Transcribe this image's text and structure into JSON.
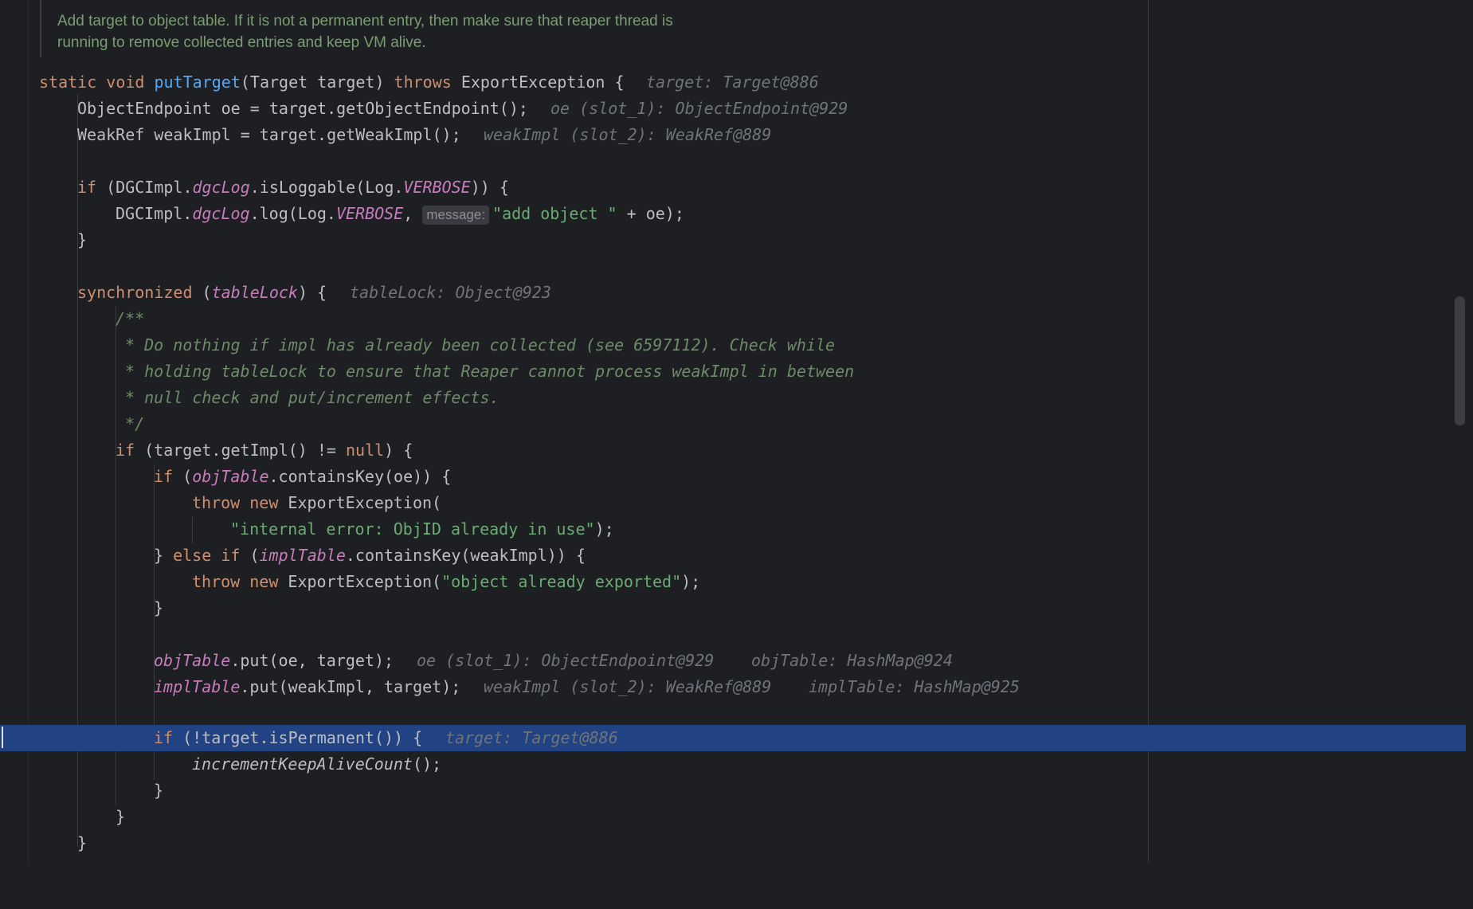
{
  "doc_comment": [
    "Add target to object table. If it is not a permanent entry, then make sure that reaper thread is",
    "running to remove collected entries and keep VM alive."
  ],
  "code": {
    "l1": {
      "kw1": "static",
      "kw2": "void",
      "fn": "putTarget",
      "p1": "(Target target) ",
      "kw3": "throws",
      "p2": " ExportException {",
      "hint": "target: Target@886"
    },
    "l2": {
      "text": "ObjectEndpoint oe = target.getObjectEndpoint();",
      "hint": "oe (slot_1): ObjectEndpoint@929"
    },
    "l3": {
      "text": "WeakRef weakImpl = target.getWeakImpl();",
      "hint": "weakImpl (slot_2): WeakRef@889"
    },
    "l5": {
      "kw": "if",
      "p1": " (DGCImpl.",
      "fld": "dgcLog",
      "p2": ".isLoggable(Log.",
      "fld2": "VERBOSE",
      "p3": ")) {"
    },
    "l6": {
      "p1": "DGCImpl.",
      "fld": "dgcLog",
      "p2": ".log(Log.",
      "fld2": "VERBOSE",
      "p3": ", ",
      "pill": "message:",
      "str": "\"add object \"",
      "p4": " + oe);"
    },
    "l7": {
      "text": "}"
    },
    "l9": {
      "kw": "synchronized",
      "p1": " (",
      "fld": "tableLock",
      "p2": ") {",
      "hint": "tableLock: Object@923"
    },
    "c1": "/**",
    "c2": " * Do nothing if impl has already been collected (see 6597112). Check while",
    "c3": " * holding tableLock to ensure that Reaper cannot process weakImpl in between",
    "c4": " * null check and put/increment effects.",
    "c5": " */",
    "l15": {
      "kw": "if",
      "p1": " (target.getImpl() != ",
      "kw2": "null",
      "p2": ") {"
    },
    "l16": {
      "kw": "if",
      "p1": " (",
      "fld": "objTable",
      "p2": ".containsKey(oe)) {"
    },
    "l17": {
      "kw": "throw",
      "kw2": "new",
      "p1": " ExportException("
    },
    "l18": {
      "str": "\"internal error: ObjID already in use\"",
      "p1": ");"
    },
    "l19": {
      "p1": "} ",
      "kw": "else",
      "kw2": "if",
      "p2": " (",
      "fld": "implTable",
      "p3": ".containsKey(weakImpl)) {"
    },
    "l20": {
      "kw": "throw",
      "kw2": "new",
      "p1": " ExportException(",
      "str": "\"object already exported\"",
      "p2": ");"
    },
    "l21": {
      "text": "}"
    },
    "l23": {
      "fld": "objTable",
      "p1": ".put(oe, target);",
      "hint1": "oe (slot_1): ObjectEndpoint@929",
      "hint2": "objTable: HashMap@924"
    },
    "l24": {
      "fld": "implTable",
      "p1": ".put(weakImpl, target);",
      "hint1": "weakImpl (slot_2): WeakRef@889",
      "hint2": "implTable: HashMap@925"
    },
    "l26": {
      "kw": "if",
      "p1": " (!target.isPermanent()) {",
      "hint": "target: Target@886"
    },
    "l27": {
      "ital": "incrementKeepAliveCount",
      "p1": "();"
    },
    "l28": {
      "text": "}"
    },
    "l29": {
      "text": "}"
    },
    "l30": {
      "text": "}"
    }
  },
  "colors": {
    "background": "#1e1f22",
    "keyword": "#cf8e6d",
    "function": "#56a8f5",
    "field": "#c77dbb",
    "string": "#6aab73",
    "comment": "#6f8a6a",
    "hint": "#6f737a",
    "highlight": "#214283"
  }
}
